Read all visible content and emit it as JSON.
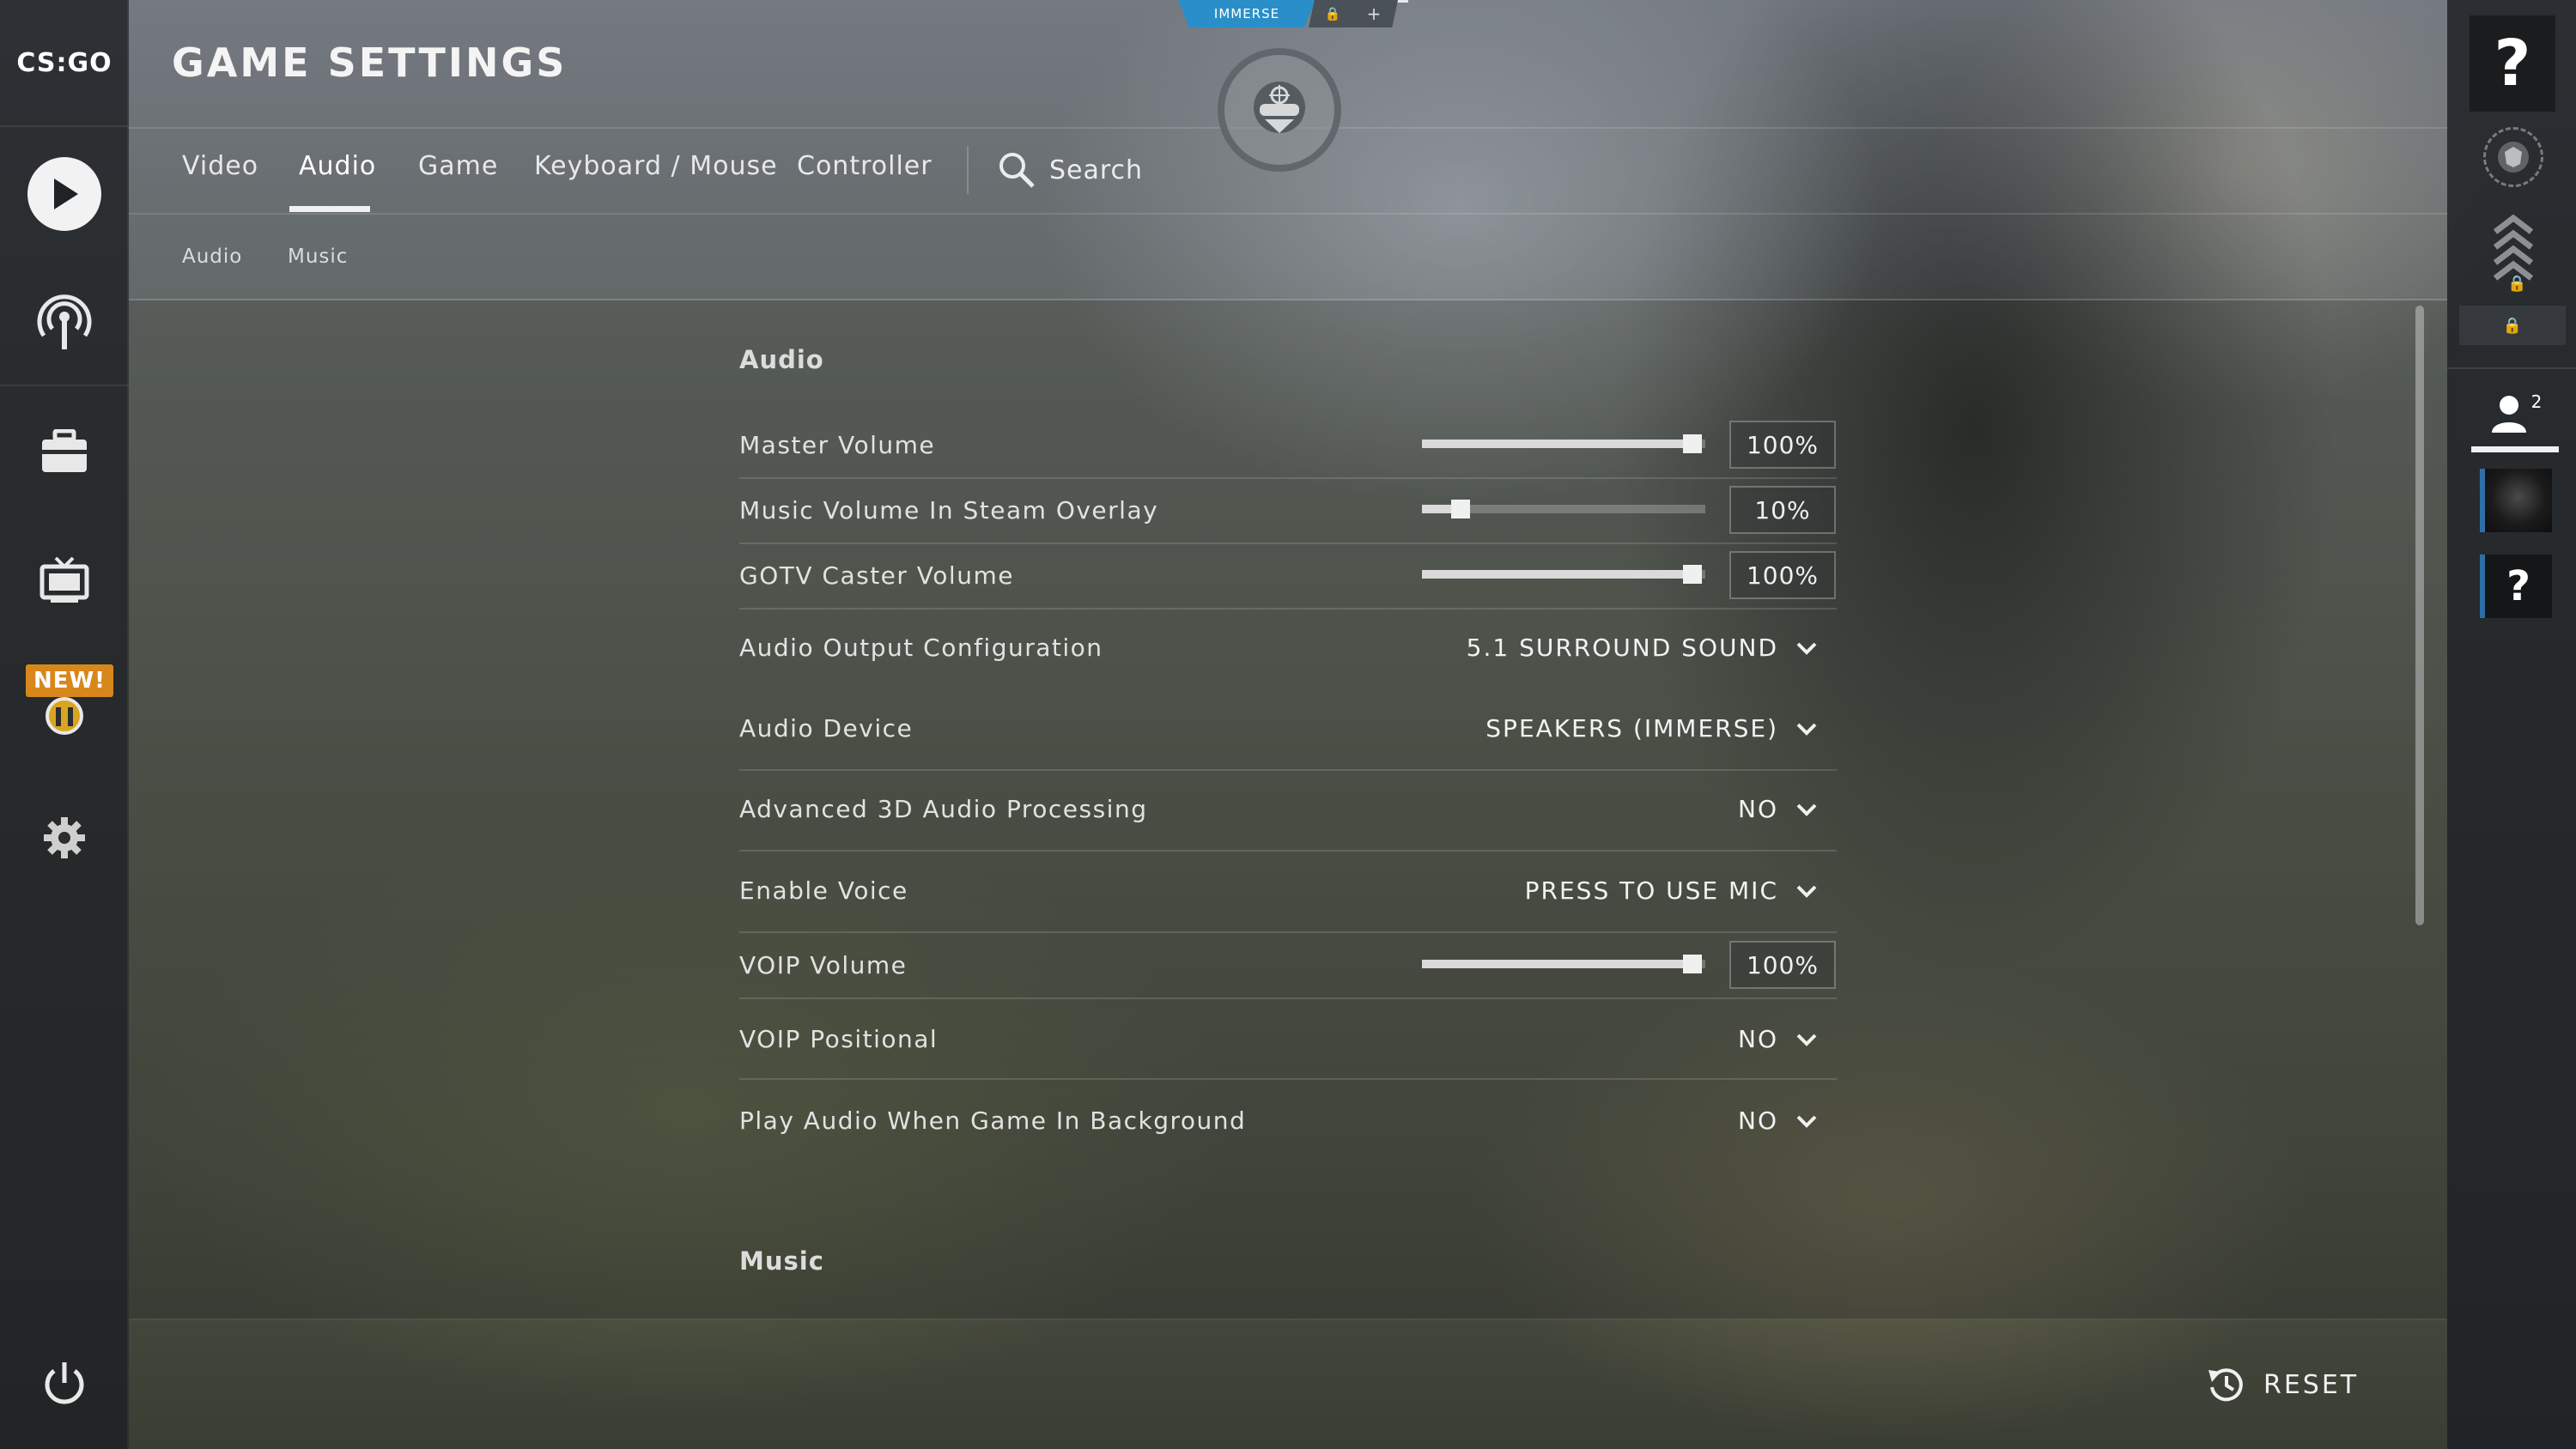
{
  "app": {
    "logo_text": "CS:GO"
  },
  "overlay": {
    "immerse_label": "IMMERSE",
    "lock_icon": "🔒",
    "plus_label": "+"
  },
  "header": {
    "title": "GAME SETTINGS"
  },
  "tabs": [
    {
      "label": "Video"
    },
    {
      "label": "Audio",
      "active": true
    },
    {
      "label": "Game"
    },
    {
      "label": "Keyboard / Mouse"
    },
    {
      "label": "Controller"
    }
  ],
  "search": {
    "label": "Search"
  },
  "subtabs": [
    {
      "label": "Audio"
    },
    {
      "label": "Music"
    }
  ],
  "nav": {
    "new_badge": "NEW!"
  },
  "sections": {
    "audio": {
      "title": "Audio",
      "master_volume": {
        "label": "Master Volume",
        "value": "100%",
        "level": 1.0
      },
      "music_volume": {
        "label": "Music Volume In Steam Overlay",
        "value": "10%",
        "level": 0.1
      },
      "gotv_volume": {
        "label": "GOTV Caster Volume",
        "value": "100%",
        "level": 1.0
      },
      "output_config": {
        "label": "Audio Output Configuration",
        "value": "5.1 SURROUND SOUND"
      },
      "audio_device": {
        "label": "Audio Device",
        "value": "SPEAKERS (IMMERSE)"
      },
      "advanced_3d": {
        "label": "Advanced 3D Audio Processing",
        "value": "NO"
      },
      "enable_voice": {
        "label": "Enable Voice",
        "value": "PRESS TO USE MIC"
      },
      "voip_volume": {
        "label": "VOIP Volume",
        "value": "100%",
        "level": 1.0
      },
      "voip_positional": {
        "label": "VOIP Positional",
        "value": "NO"
      },
      "play_in_background": {
        "label": "Play Audio When Game In Background",
        "value": "NO"
      }
    },
    "music": {
      "title": "Music"
    }
  },
  "footer": {
    "reset_label": "RESET"
  },
  "right_panel": {
    "help_glyph": "?",
    "friends_count": "2"
  },
  "colors": {
    "accent_blue": "#2a8fc8",
    "new_badge": "#d8871c"
  }
}
